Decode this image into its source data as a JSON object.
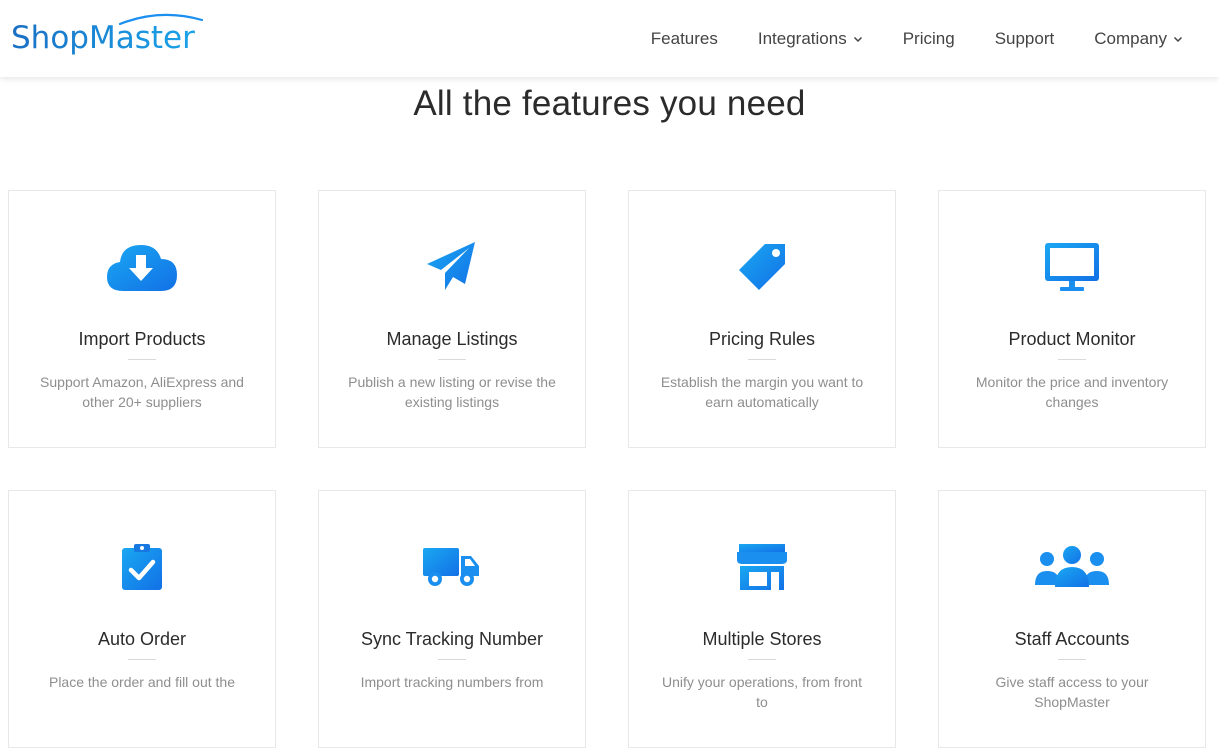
{
  "brand": {
    "logo_text": "ShopMaster",
    "accent_color": "#1a8fef"
  },
  "nav": {
    "items": [
      {
        "label": "Features",
        "dropdown": false
      },
      {
        "label": "Integrations",
        "dropdown": true
      },
      {
        "label": "Pricing",
        "dropdown": false
      },
      {
        "label": "Support",
        "dropdown": false
      },
      {
        "label": "Company",
        "dropdown": true
      }
    ]
  },
  "section": {
    "title": "All the features you need"
  },
  "features": [
    {
      "icon": "cloud-download-icon",
      "title": "Import Products",
      "desc": "Support Amazon, AliExpress and other 20+ suppliers"
    },
    {
      "icon": "paper-plane-icon",
      "title": "Manage Listings",
      "desc": "Publish a new listing or revise the existing listings"
    },
    {
      "icon": "price-tag-icon",
      "title": "Pricing Rules",
      "desc": "Establish the margin you want to earn automatically"
    },
    {
      "icon": "monitor-icon",
      "title": "Product Monitor",
      "desc": "Monitor the price and inventory changes"
    },
    {
      "icon": "clipboard-check-icon",
      "title": "Auto Order",
      "desc": "Place the order and fill out the"
    },
    {
      "icon": "delivery-truck-icon",
      "title": "Sync Tracking Number",
      "desc": "Import tracking numbers from"
    },
    {
      "icon": "storefront-icon",
      "title": "Multiple Stores",
      "desc": "Unify your operations, from front to"
    },
    {
      "icon": "users-group-icon",
      "title": "Staff Accounts",
      "desc": "Give staff access to your ShopMaster"
    }
  ]
}
